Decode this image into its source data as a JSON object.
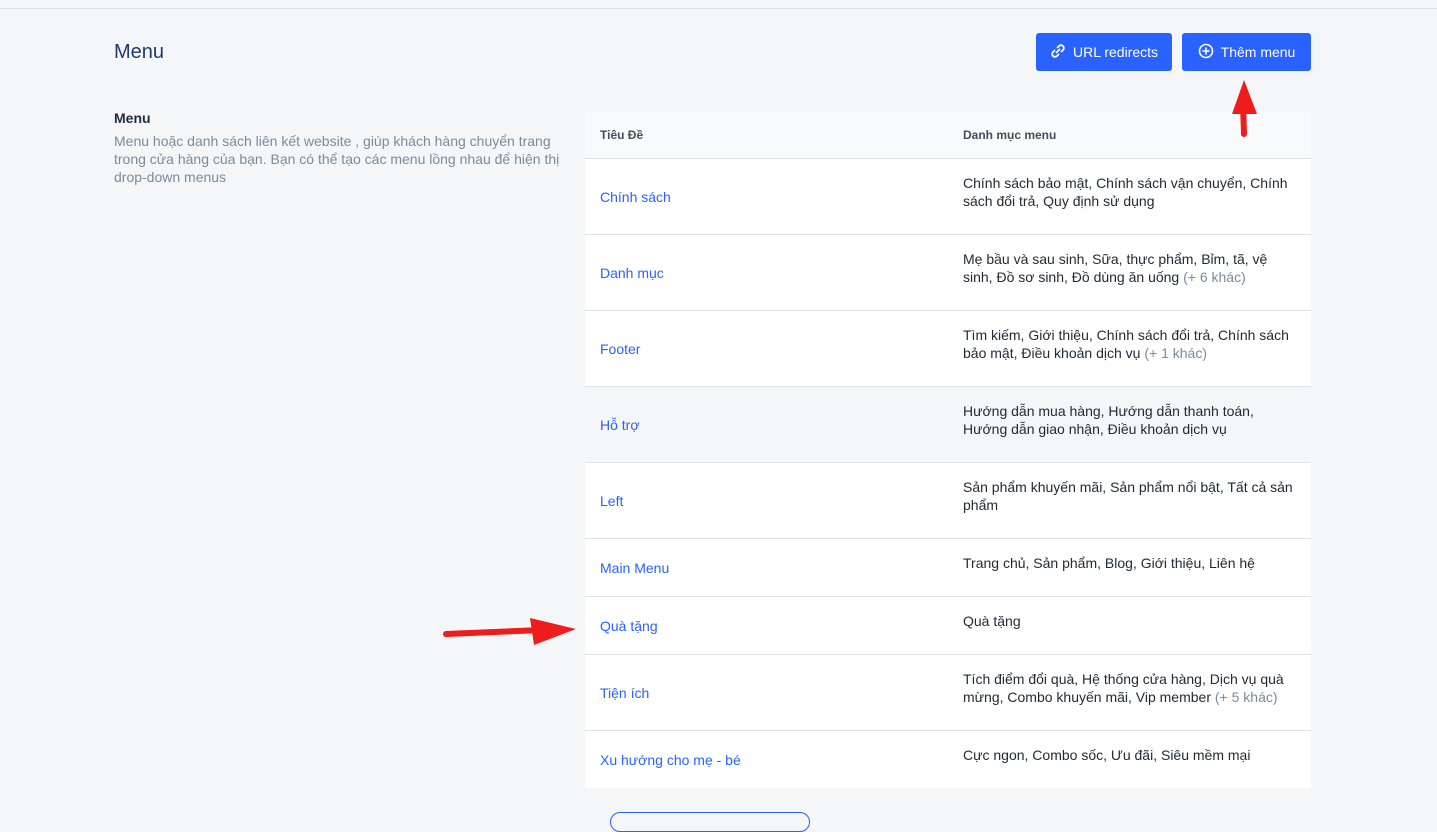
{
  "header": {
    "title": "Menu",
    "url_redirects_label": "URL redirects",
    "add_menu_label": "Thêm menu",
    "accent": "#2962ff"
  },
  "description": {
    "title": "Menu",
    "text": "Menu hoặc danh sách liên kết website , giúp khách hàng chuyển trang trong cửa hàng của bạn. Bạn có thể tạo các menu lồng nhau để hiện thị drop-down menus"
  },
  "table": {
    "columns": [
      "Tiêu Đề",
      "Danh mục menu"
    ],
    "rows": [
      {
        "title": "Chính sách",
        "items": "Chính sách bảo mật, Chính sách vận chuyển, Chính sách đổi trả, Quy định sử dụng",
        "more": ""
      },
      {
        "title": "Danh mục",
        "items": "Mẹ bầu và sau sinh, Sữa, thực phẩm, Bỉm, tã, vệ sinh, Đồ sơ sinh, Đồ dùng ăn uống",
        "more": "(+ 6 khác)"
      },
      {
        "title": "Footer",
        "items": "Tìm kiếm, Giới thiệu, Chính sách đổi trả, Chính sách bảo mật, Điều khoản dịch vụ",
        "more": "(+ 1 khác)"
      },
      {
        "title": "Hỗ trợ",
        "items": "Hướng dẫn mua hàng, Hướng dẫn thanh toán, Hướng dẫn giao nhận, Điều khoản dịch vụ",
        "more": ""
      },
      {
        "title": "Left",
        "items": "Sản phẩm khuyến mãi, Sản phẩm nổi bật, Tất cả sản phẩm",
        "more": ""
      },
      {
        "title": "Main Menu",
        "items": "Trang chủ, Sản phẩm, Blog, Giới thiệu, Liên hệ",
        "more": ""
      },
      {
        "title": "Quà tặng",
        "items": "Quà tặng",
        "more": ""
      },
      {
        "title": "Tiện ích",
        "items": "Tích điểm đổi quà, Hệ thống cửa hàng, Dịch vụ quà mừng, Combo khuyến mãi, Vip member",
        "more": "(+ 5 khác)"
      },
      {
        "title": "Xu hướng cho mẹ - bé",
        "items": "Cực ngon, Combo sốc, Ưu đãi, Siêu mềm mại",
        "more": ""
      }
    ]
  },
  "icons": {
    "redirect": "link-icon",
    "add": "plus-circle-icon"
  }
}
